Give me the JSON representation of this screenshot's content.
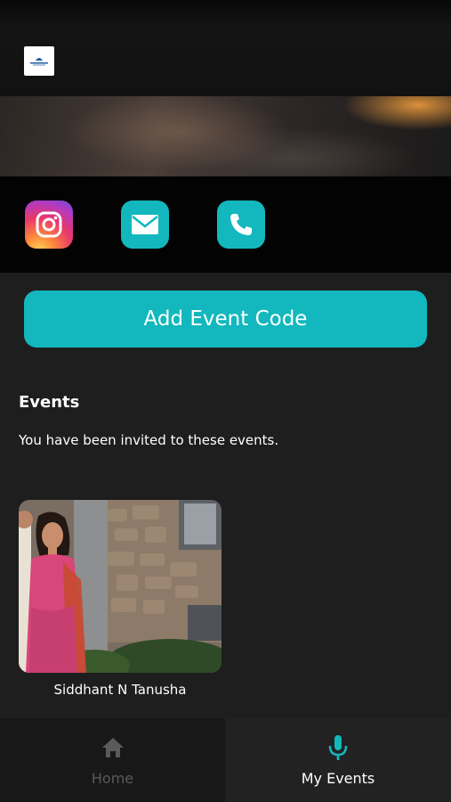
{
  "header": {
    "logo_icon": "brand-logo-icon"
  },
  "social": {
    "items": [
      {
        "name": "instagram",
        "icon": "instagram-icon"
      },
      {
        "name": "email",
        "icon": "mail-icon"
      },
      {
        "name": "phone",
        "icon": "phone-icon"
      }
    ],
    "accent": "#12b8bd"
  },
  "actions": {
    "add_event_code": "Add Event Code"
  },
  "events": {
    "title": "Events",
    "subtitle": "You have been invited to these events.",
    "items": [
      {
        "name": "Siddhant N Tanusha"
      }
    ]
  },
  "nav": {
    "home": {
      "label": "Home",
      "icon": "home-icon"
    },
    "my_events": {
      "label": "My Events",
      "icon": "microphone-icon",
      "active": true
    }
  },
  "colors": {
    "accent": "#12b8bd",
    "background": "#1e1e1e"
  }
}
